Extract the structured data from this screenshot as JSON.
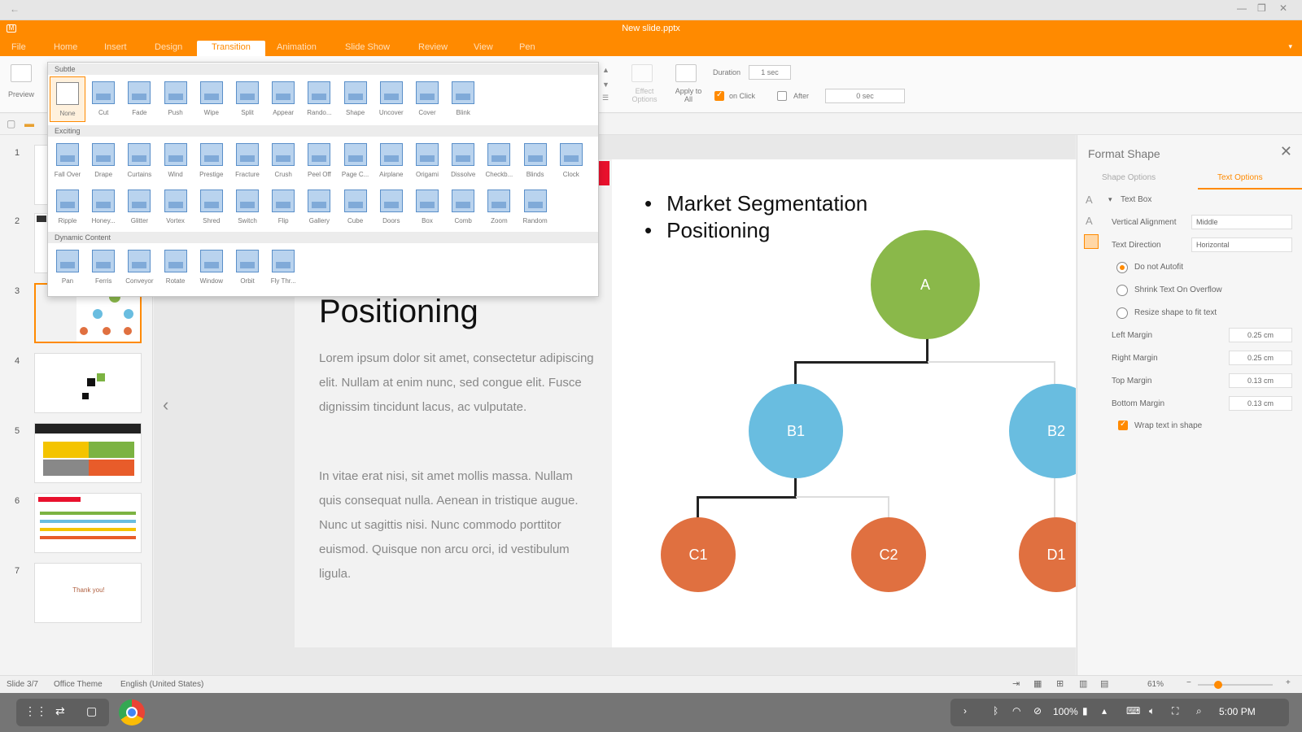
{
  "window": {
    "title": "New slide.pptx"
  },
  "menu": [
    "File",
    "Home",
    "Insert",
    "Design",
    "Transition",
    "Animation",
    "Slide Show",
    "Review",
    "View",
    "Pen"
  ],
  "menu_active": "Transition",
  "ribbon": {
    "preview": "Preview",
    "effect_options": "Effect Options",
    "apply_to_all": "Apply to All",
    "duration_label": "Duration",
    "duration_value": "1 sec",
    "on_click": "on Click",
    "after": "After",
    "after_value": "0 sec"
  },
  "transitions": {
    "subtle_header": "Subtle",
    "subtle": [
      "None",
      "Cut",
      "Fade",
      "Push",
      "Wipe",
      "Split",
      "Appear",
      "Rando...",
      "Shape",
      "Uncover",
      "Cover",
      "Blink"
    ],
    "exciting_header": "Exciting",
    "exciting_row1": [
      "Fall Over",
      "Drape",
      "Curtains",
      "Wind",
      "Prestige",
      "Fracture",
      "Crush",
      "Peel Off",
      "Page C...",
      "Airplane",
      "Origami",
      "Dissolve",
      "Checkb...",
      "Blinds",
      "Clock"
    ],
    "exciting_row2": [
      "Ripple",
      "Honey...",
      "Glitter",
      "Vortex",
      "Shred",
      "Switch",
      "Flip",
      "Gallery",
      "Cube",
      "Doors",
      "Box",
      "Comb",
      "Zoom",
      "Random"
    ],
    "dynamic_header": "Dynamic Content",
    "dynamic": [
      "Pan",
      "Ferris",
      "Conveyor",
      "Rotate",
      "Window",
      "Orbit",
      "Fly Thr..."
    ]
  },
  "slides_panel": {
    "numbers": [
      "1",
      "2",
      "3",
      "4",
      "5",
      "6",
      "7"
    ],
    "thumb7_text": "Thank you!"
  },
  "slide": {
    "title": "Positioning",
    "paragraph1": "Lorem ipsum dolor sit amet, consectetur adipiscing elit. Nullam at enim nunc, sed congue elit. Fusce dignissim tincidunt lacus, ac vulputate.",
    "paragraph2": "In vitae erat nisi, sit amet mollis massa. Nullam quis consequat nulla. Aenean in tristique augue. Nunc ut sagittis nisi. Nunc commodo porttitor euismod. Quisque non arcu orci, id vestibulum ligula.",
    "bullets": [
      "Market Segmentation",
      "Positioning"
    ],
    "nodes": {
      "a": "A",
      "b1": "B1",
      "b2": "B2",
      "c1": "C1",
      "c2": "C2",
      "d1": "D1"
    }
  },
  "format_pane": {
    "title": "Format Shape",
    "tab_shape": "Shape Options",
    "tab_text": "Text Options",
    "section": "Text Box",
    "vertical_alignment_label": "Vertical Alignment",
    "vertical_alignment_value": "Middle",
    "text_direction_label": "Text Direction",
    "text_direction_value": "Horizontal",
    "autofit_none": "Do not Autofit",
    "autofit_shrink": "Shrink Text On Overflow",
    "autofit_resize": "Resize shape to fit text",
    "left_margin_label": "Left Margin",
    "left_margin_value": "0.25 cm",
    "right_margin_label": "Right Margin",
    "right_margin_value": "0.25 cm",
    "top_margin_label": "Top Margin",
    "top_margin_value": "0.13 cm",
    "bottom_margin_label": "Bottom Margin",
    "bottom_margin_value": "0.13 cm",
    "wrap_text": "Wrap text in shape"
  },
  "status": {
    "slide_count": "Slide 3/7",
    "theme": "Office Theme",
    "language": "English (United States)",
    "zoom": "61%"
  },
  "taskbar": {
    "battery": "100%",
    "time": "5:00 PM"
  },
  "colors": {
    "accent": "#ff8a00",
    "node_green": "#8ab84a",
    "node_blue": "#69bde0",
    "node_orange": "#e07040"
  }
}
